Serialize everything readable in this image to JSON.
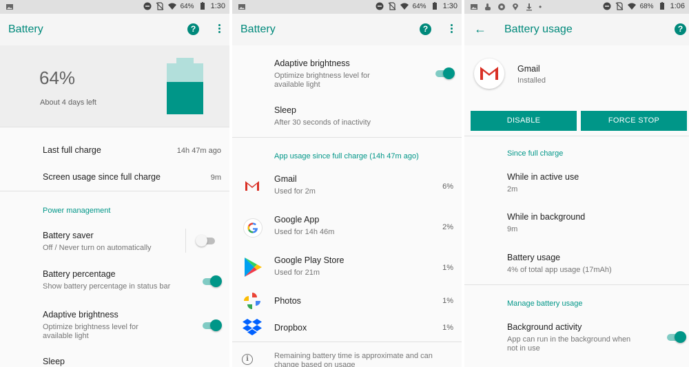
{
  "panel1": {
    "status": {
      "battery": "64%",
      "time": "1:30"
    },
    "appbar": {
      "title": "Battery",
      "help": "?"
    },
    "hero": {
      "percent": "64%",
      "time_left": "About 4 days left",
      "level": 0.64
    },
    "last_full_charge": {
      "label": "Last full charge",
      "value": "14h 47m ago"
    },
    "screen_usage": {
      "label": "Screen usage since full charge",
      "value": "9m"
    },
    "section_power": "Power management",
    "battery_saver": {
      "label": "Battery saver",
      "sub": "Off / Never turn on automatically"
    },
    "battery_percentage": {
      "label": "Battery percentage",
      "sub": "Show battery percentage in status bar"
    },
    "adaptive_brightness": {
      "label": "Adaptive brightness",
      "sub": "Optimize brightness level for available light"
    },
    "sleep": {
      "label": "Sleep"
    }
  },
  "panel2": {
    "status": {
      "battery": "64%",
      "time": "1:30"
    },
    "appbar": {
      "title": "Battery",
      "help": "?"
    },
    "adaptive_brightness": {
      "label": "Adaptive brightness",
      "sub": "Optimize brightness level for available light"
    },
    "sleep": {
      "label": "Sleep",
      "sub": "After 30 seconds of inactivity"
    },
    "section_usage": "App usage since full charge (14h 47m ago)",
    "apps": [
      {
        "name": "Gmail",
        "sub": "Used for 2m",
        "value": "6%",
        "icon": "gmail-icon"
      },
      {
        "name": "Google App",
        "sub": "Used for 14h 46m",
        "value": "2%",
        "icon": "google-icon"
      },
      {
        "name": "Google Play Store",
        "sub": "Used for 21m",
        "value": "1%",
        "icon": "play-store-icon"
      },
      {
        "name": "Photos",
        "sub": "",
        "value": "1%",
        "icon": "photos-icon"
      },
      {
        "name": "Dropbox",
        "sub": "",
        "value": "1%",
        "icon": "dropbox-icon"
      }
    ],
    "footer_note": "Remaining battery time is approximate and can change based on usage"
  },
  "panel3": {
    "status": {
      "battery": "68%",
      "time": "1:06"
    },
    "appbar": {
      "title": "Battery usage",
      "help": "?"
    },
    "app": {
      "name": "Gmail",
      "status": "Installed"
    },
    "disable_label": "DISABLE",
    "force_stop_label": "FORCE STOP",
    "section_since": "Since full charge",
    "active_use": {
      "label": "While in active use",
      "value": "2m"
    },
    "background": {
      "label": "While in background",
      "value": "9m"
    },
    "battery_usage": {
      "label": "Battery usage",
      "value": "4% of total app usage (17mAh)"
    },
    "section_manage": "Manage battery usage",
    "background_activity": {
      "label": "Background activity",
      "sub": "App can run in the background when not in use"
    }
  },
  "colors": {
    "accent": "#009688",
    "title": "#00897b",
    "hero_bg": "#eeeeee"
  }
}
